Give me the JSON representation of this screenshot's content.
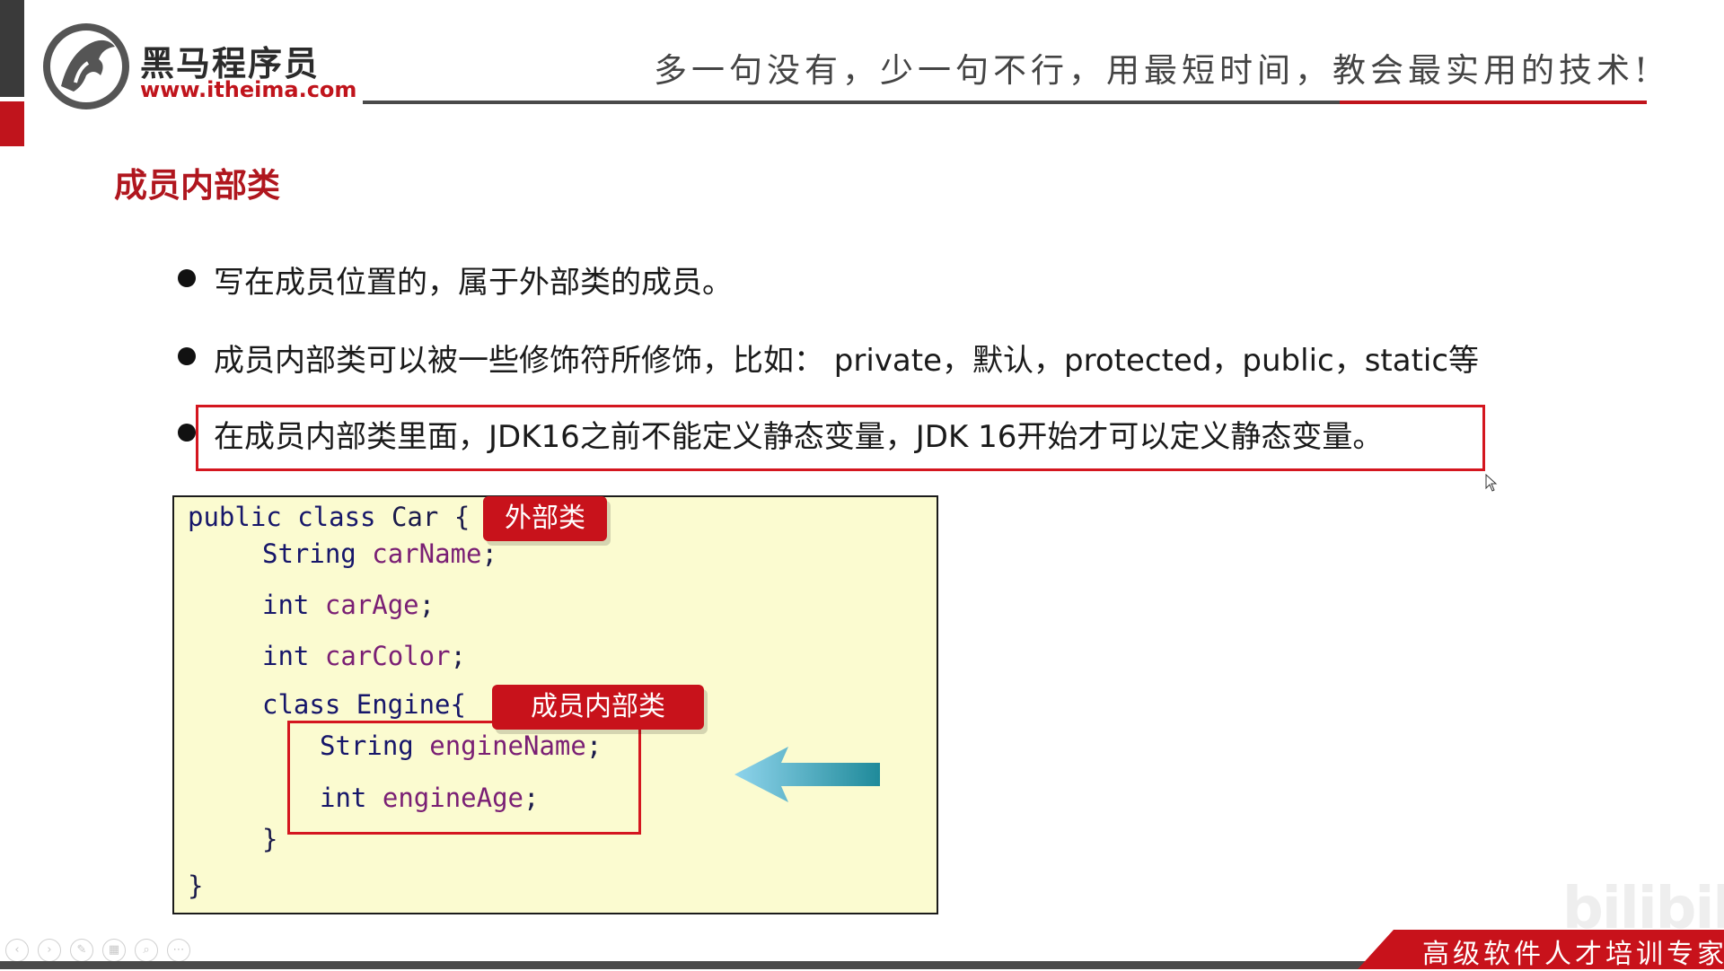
{
  "header": {
    "logo_name": "黑马程序员",
    "logo_url": "www.itheima.com",
    "slogan": "多一句没有，少一句不行，用最短时间，教会最实用的技术!"
  },
  "section_title": "成员内部类",
  "bullets": [
    "写在成员位置的，属于外部类的成员。",
    "成员内部类可以被一些修饰符所修饰，比如： private，默认，protected，public，static等",
    "在成员内部类里面，JDK16之前不能定义静态变量，JDK 16开始才可以定义静态变量。"
  ],
  "code": {
    "line1_kw": "public class",
    "line1_rest": " Car {",
    "line2_type": "String",
    "line2_name": "carName",
    "line3_type": "int",
    "line3_name": "carAge",
    "line4_type": "int",
    "line4_name": "carColor",
    "line5": "class Engine{",
    "line6_type": "String",
    "line6_name": "engineName",
    "line7_type": "int",
    "line7_name": "engineAge",
    "line8": "}",
    "line9": "}",
    "semicolon": ";"
  },
  "tags": {
    "outer": "外部类",
    "inner": "成员内部类"
  },
  "watermark": "bilibili",
  "footer": {
    "slogan": "高级软件人才培训专家"
  },
  "playback_controls": [
    "prev-icon",
    "next-icon",
    "pen-icon",
    "slides-icon",
    "zoom-icon",
    "more-icon"
  ],
  "colors": {
    "brand_red": "#c0141c",
    "code_bg": "#fbfbd0",
    "arrow_start": "#8fd4ec",
    "arrow_end": "#1f8a9a"
  }
}
